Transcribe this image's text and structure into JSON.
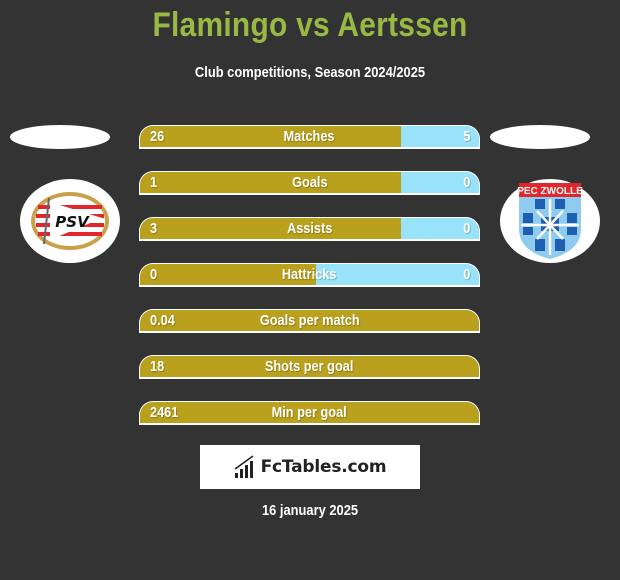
{
  "header": {
    "title": "Flamingo vs Aertssen",
    "subtitle": "Club competitions, Season 2024/2025"
  },
  "teams": {
    "left": {
      "logo_icon": "psv-crest-icon",
      "logo_text": "PSV"
    },
    "right": {
      "logo_icon": "pec-zwolle-crest-icon",
      "logo_text": "PEC ZWOLLE"
    }
  },
  "colors": {
    "title": "#98b943",
    "left_bar": "#b9a11d",
    "right_bar": "#98e3fa",
    "background": "#333333"
  },
  "stats": [
    {
      "label": "Matches",
      "left": "26",
      "right": "5",
      "left_share": 0.77
    },
    {
      "label": "Goals",
      "left": "1",
      "right": "0",
      "left_share": 0.77
    },
    {
      "label": "Assists",
      "left": "3",
      "right": "0",
      "left_share": 0.77
    },
    {
      "label": "Hattricks",
      "left": "0",
      "right": "0",
      "left_share": 0.52
    },
    {
      "label": "Goals per match",
      "left": "0.04",
      "right": "",
      "left_share": 1.0
    },
    {
      "label": "Shots per goal",
      "left": "18",
      "right": "",
      "left_share": 1.0
    },
    {
      "label": "Min per goal",
      "left": "2461",
      "right": "",
      "left_share": 1.0
    }
  ],
  "footer": {
    "brand": "FcTables.com",
    "brand_icon": "bar-chart-icon",
    "date": "16 january 2025"
  }
}
